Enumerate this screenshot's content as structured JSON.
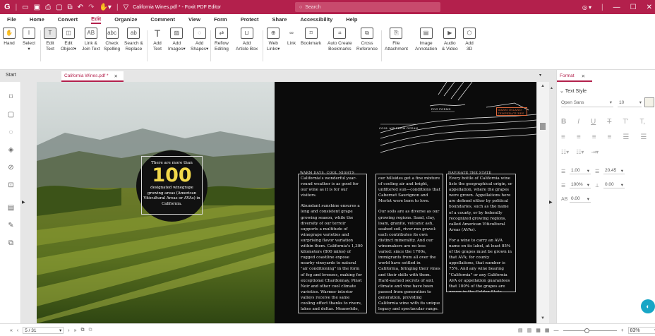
{
  "titlebar": {
    "title": "California Wines.pdf * - Foxit PDF Editor",
    "search_placeholder": "Search"
  },
  "menu": [
    "File",
    "Home",
    "Convert",
    "Edit",
    "Organize",
    "Comment",
    "View",
    "Form",
    "Protect",
    "Share",
    "Accessibility",
    "Help"
  ],
  "menu_active": "Edit",
  "ribbon": {
    "hand": "Hand",
    "select": "Select",
    "edit_text": "Edit\nText",
    "edit_object": "Edit\nObject▾",
    "link_join": "Link &\nJoin Text",
    "check_spelling": "Check\nSpelling",
    "search_replace": "Search &\nReplace",
    "add_text": "Add\nText",
    "add_images": "Add\nImages▾",
    "add_shapes": "Add\nShapes▾",
    "reflow_editing": "Reflow\nEditing",
    "add_article_box": "Add\nArticle Box",
    "web_links": "Web\nLinks▾",
    "link": "Link",
    "bookmark": "Bookmark",
    "auto_create_bookmarks": "Auto Create\nBookmarks",
    "cross_reference": "Cross\nReference",
    "file_attachment": "File\nAttachment",
    "image_annotation": "Image\nAnnotation",
    "audio_video": "Audio\n& Video",
    "add_3d": "Add\n3D"
  },
  "tabs": {
    "start": "Start",
    "document": "California Wines.pdf *"
  },
  "page": {
    "circle_top": "There are more than",
    "circle_number": "100",
    "circle_bottom": "designated winegrape growing areas (American Viticultural Areas or AVAs) in California.",
    "annotations": {
      "fog_forms": "FOG FORMS",
      "warm_inland": "WARM INLAND TEMPERATURES",
      "cool_air": "COOL AIR FROM OCEAN"
    },
    "col1_head": "WARM DAYS, COOL NIGHTS",
    "col1_p1": "California's wonderful year-round weather is as good for our wine as it is for our visitors.",
    "col1_p2": "Abundant sunshine ensures a long and consistent grape growing season, while the diversity of our terroir supports a multitude of winegrape varieties and surprising flavor variation within them. California's 1,300 kilometers (800 miles) of rugged coastline expose nearby vineyards to natural \"air conditioning\" in the form of fog and breezes, making for exceptional Chardonnay, Pinot Noir and other cool climate varieties. Warmer interior valleys receive the same cooling effect thanks to rivers, lakes and deltas. Meanwhile, vines planted along",
    "col2_p1": "our hillsides get a fine mixture of cooling air and bright, unfiltered sun—conditions that Cabernet Sauvignon and Merlot were born to love.",
    "col2_p2": "Our soils are as diverse as our growing regions. Sand, clay, loam, granite, volcanic ash, seabed soil, river-run gravel: each contributes its own distinct minerality. And our winemakers are no less varied: since the 1700s, immigrants from all over the world have settled in California, bringing their vines and their skills with them. Hard-earned secrets of soil, climate and vine have been passed from generation to generation, providing California wine with its unique legacy and spectacular range.",
    "col3_head": "NAVIGATE THE STATE",
    "col3_p1": "Every bottle of California wine lists the geographical origin, or appellation, where the grapes were grown. Appellations here are defined either by political boundaries, such as the name of a county, or by federally recognized growing regions, called American Viticultural Areas (AVAs).",
    "col3_p2": "For a wine to carry an AVA name on its label, at least 85% of the grapes must be grown in that AVA; for county appellations, that number is 75%. And any wine bearing \"California\" or any California AVA or appellation guarantees that 100% of the grapes are grown in the Golden State."
  },
  "panel": {
    "tab": "Format",
    "section": "Text Style",
    "font": "Open Sans",
    "size": "10",
    "line_spacing": "1.00",
    "para_spacing": "20.45",
    "h_scale": "100%",
    "baseline": "0.00",
    "char_spacing": "0.00"
  },
  "status": {
    "page": "5 / 31",
    "zoom": "83%"
  },
  "colors": {
    "brand": "#b3204c",
    "circle_number": "#f2d84a"
  }
}
